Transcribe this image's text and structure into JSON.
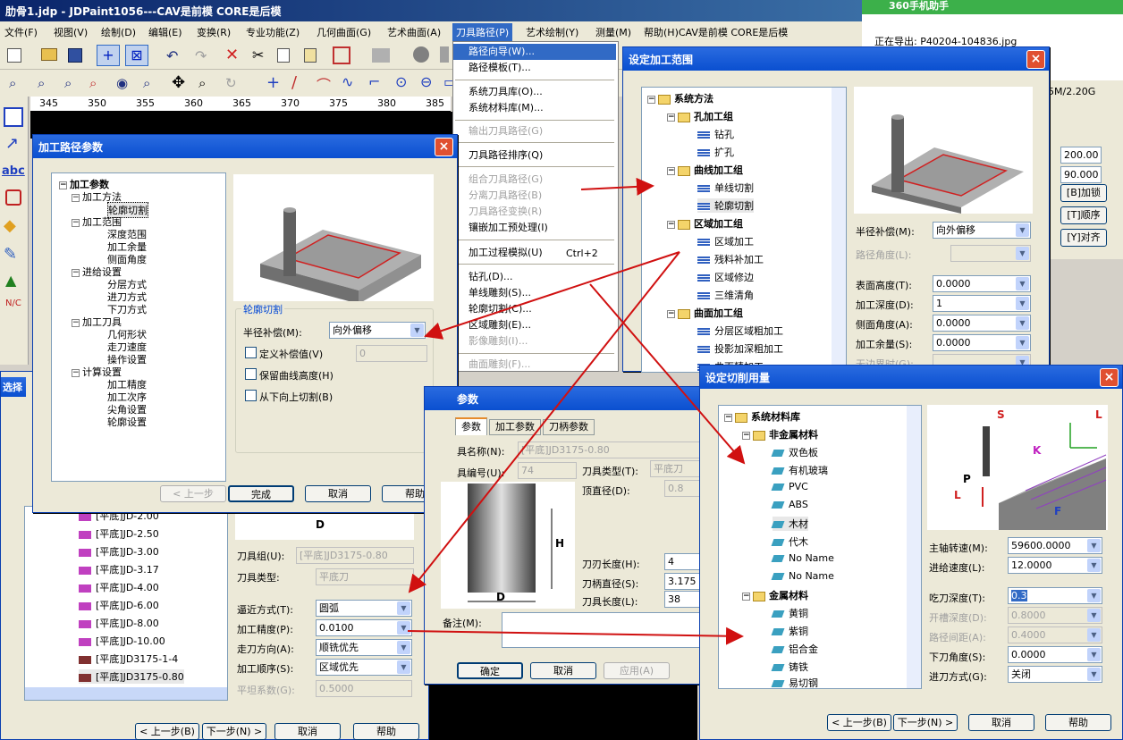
{
  "app": {
    "title": "肋骨1.jdp - JDPaint1056---CAV是前模 CORE是后模"
  },
  "menubar": [
    "文件(F)",
    "视图(V)",
    "绘制(D)",
    "编辑(E)",
    "变换(R)",
    "专业功能(Z)",
    "几何曲面(G)",
    "艺术曲面(A)",
    "刀具路径(P)",
    "艺术绘制(Y)",
    "测量(M)",
    "帮助(H)CAV是前模 CORE是后模"
  ],
  "ruler": [
    "345",
    "350",
    "355",
    "360",
    "365",
    "370",
    "375",
    "380",
    "385"
  ],
  "side360": {
    "title": "360手机助手",
    "exporting": "正在导出: P40204-104836.jpg",
    "storage": "5M/2.20G",
    "val1": "200.00",
    "val2": "90.000",
    "btn1": "[B]加锁",
    "btn2": "[T]顺序",
    "btn3": "[Y]对齐"
  },
  "path_menu": [
    "路径向导(W)...",
    "路径模板(T)...",
    "系统刀具库(O)...",
    "系统材料库(M)...",
    "输出刀具路径(G)",
    "刀具路径排序(Q)",
    "组合刀具路径(G)",
    "分离刀具路径(B)",
    "刀具路径变换(R)",
    "镶嵌加工预处理(I)",
    "加工过程模拟(U)",
    "钻孔(D)...",
    "单线雕刻(S)...",
    "轮廓切割(C)...",
    "区域雕刻(E)...",
    "影像雕刻(I)...",
    "曲面雕刻(F)..."
  ],
  "path_menu_shortcut": "Ctrl+2",
  "dlg_params": {
    "title": "加工路径参数",
    "tree": [
      "加工参数",
      "加工方法",
      "轮廓切割",
      "加工范围",
      "深度范围",
      "加工余量",
      "侧面角度",
      "进给设置",
      "分层方式",
      "进刀方式",
      "下刀方式",
      "加工刀具",
      "几何形状",
      "走刀速度",
      "操作设置",
      "计算设置",
      "加工精度",
      "加工次序",
      "尖角设置",
      "轮廓设置"
    ],
    "group": "轮廓切割",
    "radius_label": "半径补偿(M):",
    "radius_value": "向外偏移",
    "chk1": "定义补偿值(V)",
    "chk1_value": "0",
    "chk2": "保留曲线高度(H)",
    "chk3": "从下向上切割(B)",
    "prev": "< 上一步",
    "finish": "完成",
    "cancel": "取消",
    "help": "帮助"
  },
  "dlg_range": {
    "title": "设定加工范围",
    "tree": [
      "系统方法",
      "孔加工组",
      "钻孔",
      "扩孔",
      "曲线加工组",
      "单线切割",
      "轮廓切割",
      "区域加工组",
      "区域加工",
      "残料补加工",
      "区域修边",
      "三维清角",
      "曲面加工组",
      "分层区域粗加工",
      "投影加深粗加工",
      "曲面精加工"
    ],
    "radius_label": "半径补偿(M):",
    "radius_value": "向外偏移",
    "angle_label": "路径角度(L):",
    "surf_label": "表面高度(T):",
    "surf_value": "0.0000",
    "depth_label": "加工深度(D):",
    "depth_value": "1",
    "side_label": "侧面角度(A):",
    "side_value": "0.0000",
    "remain_label": "加工余量(S):",
    "remain_value": "0.0000",
    "boundary_label": "无边界时(G):"
  },
  "dlg_tool": {
    "title": "参数",
    "tabs": [
      "参数",
      "加工参数",
      "刀柄参数"
    ],
    "name_label": "具名称(N):",
    "name_value": "[平底]JD3175-0.80",
    "num_label": "具编号(U):",
    "num_value": "74",
    "type_label": "刀具类型(T):",
    "type_value": "平底刀",
    "top_label": "顶直径(D):",
    "top_value": "0.8",
    "blade_label": "刀刃长度(H):",
    "blade_value": "4",
    "shank_label": "刀柄直径(S):",
    "shank_value": "3.175",
    "len_label": "刀具长度(L):",
    "len_value": "38",
    "note_label": "备注(M):",
    "ok": "确定",
    "cancel": "取消",
    "apply": "应用(A)",
    "H": "H",
    "D": "D"
  },
  "left_panel": {
    "tree_title": "选择",
    "tools": [
      "[平底]JD-2.00",
      "[平底]JD-2.50",
      "[平底]JD-3.00",
      "[平底]JD-3.17",
      "[平底]JD-4.00",
      "[平底]JD-6.00",
      "[平底]JD-8.00",
      "[平底]JD-10.00",
      "[平底]JD3175-1-4",
      "[平底]JD3175-0.80"
    ],
    "D": "D",
    "group_label": "刀具组(U):",
    "group_value": "[平底]JD3175-0.80",
    "type_label": "刀具类型:",
    "type_value": "平底刀",
    "approach_label": "逼近方式(T):",
    "approach_value": "圆弧",
    "precision_label": "加工精度(P):",
    "precision_value": "0.0100",
    "dir_label": "走刀方向(A):",
    "dir_value": "顺铣优先",
    "order_label": "加工顺序(S):",
    "order_value": "区域优先",
    "flat_label": "平坦系数(G):",
    "flat_value": "0.5000",
    "prev": "< 上一步(B)",
    "next": "下一步(N) >",
    "cancel": "取消",
    "help": "帮助"
  },
  "dlg_cut": {
    "title": "设定切削用量",
    "tree": [
      "系统材料库",
      "非金属材料",
      "双色板",
      "有机玻璃",
      "PVC",
      "ABS",
      "木材",
      "代木",
      "No Name",
      "No Name",
      "金属材料",
      "黄铜",
      "紫铜",
      "铝合金",
      "铸铁",
      "易切钢"
    ],
    "diag": {
      "S": "S",
      "L": "L",
      "L2": "L",
      "K": "K",
      "P": "P",
      "F": "F"
    },
    "spindle_label": "主轴转速(M):",
    "spindle_value": "59600.0000",
    "feed_label": "进给速度(L):",
    "feed_value": "12.0000",
    "cutdepth_label": "吃刀深度(T):",
    "cutdepth_value": "0.3",
    "slot_label": "开槽深度(D):",
    "slot_value": "0.8000",
    "step_label": "路径间距(A):",
    "step_value": "0.4000",
    "down_label": "下刀角度(S):",
    "down_value": "0.0000",
    "entry_label": "进刀方式(G):",
    "entry_value": "关闭",
    "prev": "< 上一步(B)",
    "next": "下一步(N) >",
    "cancel": "取消",
    "help": "帮助"
  }
}
